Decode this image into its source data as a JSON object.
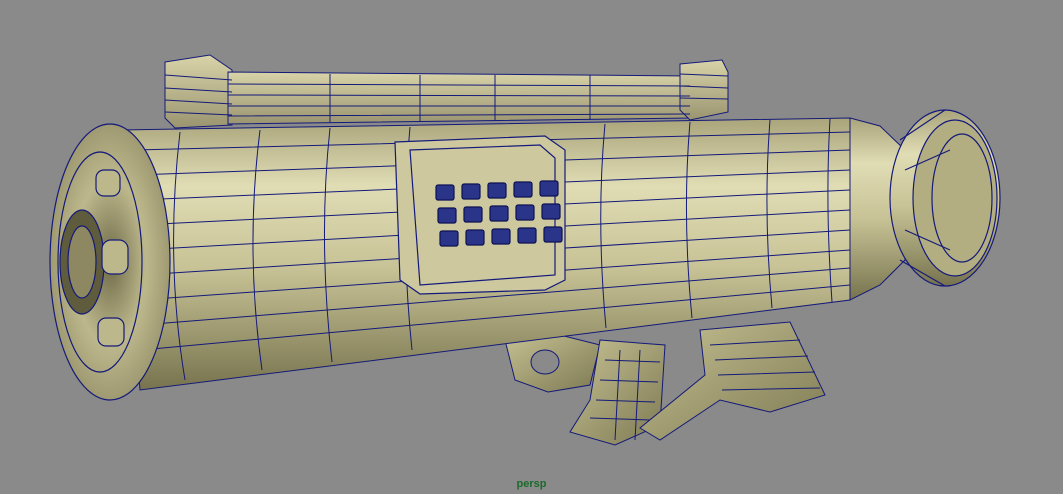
{
  "viewport": {
    "camera_label": "persp",
    "background_color": "#8a8a8a",
    "mesh_fill_color": "#c9c49a",
    "wireframe_color": "#141a7a",
    "label_color": "#1a6b2a"
  },
  "scene": {
    "model": "rocket-launcher-mesh",
    "display_mode": "wireframe-on-shaded"
  }
}
